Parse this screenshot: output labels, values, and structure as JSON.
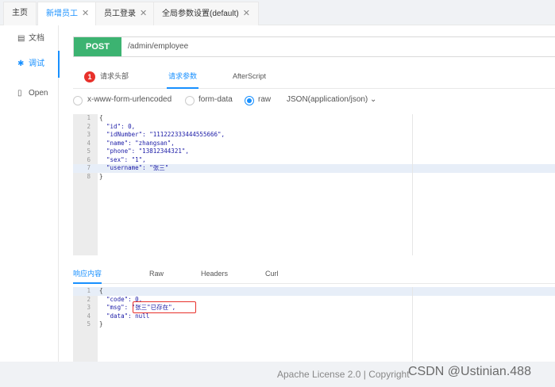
{
  "tabs": [
    {
      "label": "主页",
      "closable": false
    },
    {
      "label": "新增员工",
      "closable": true
    },
    {
      "label": "员工登录",
      "closable": true
    },
    {
      "label": "全局参数设置(default)",
      "closable": true
    }
  ],
  "sidebar": {
    "items": [
      {
        "label": "文档"
      },
      {
        "label": "调试"
      },
      {
        "label": "Open"
      }
    ]
  },
  "request": {
    "method": "POST",
    "url": "/admin/employee",
    "subtabs": {
      "headers_badge": "1",
      "headers": "请求头部",
      "params": "请求参数",
      "after_script": "AfterScript"
    },
    "body_types": {
      "urlencoded": "x-www-form-urlencoded",
      "form_data": "form-data",
      "raw": "raw",
      "raw_format": "JSON(application/json)"
    },
    "lines": [
      {
        "num": "1",
        "text": "{"
      },
      {
        "num": "2",
        "text": "  \"id\": 0,"
      },
      {
        "num": "3",
        "text": "  \"idNumber\": \"111222333444555666\","
      },
      {
        "num": "4",
        "text": "  \"name\": \"zhangsan\","
      },
      {
        "num": "5",
        "text": "  \"phone\": \"13812344321\","
      },
      {
        "num": "6",
        "text": "  \"sex\": \"1\","
      },
      {
        "num": "7",
        "text": "  \"username\": \"张三\""
      },
      {
        "num": "8",
        "text": "}"
      }
    ]
  },
  "response": {
    "tabs": {
      "content": "响应内容",
      "raw": "Raw",
      "headers": "Headers",
      "curl": "Curl"
    },
    "lines": [
      {
        "num": "1",
        "text": "{"
      },
      {
        "num": "2",
        "text": "  \"code\": 0,"
      },
      {
        "num": "3",
        "text": "  \"msg\": \"张三\"已存在\","
      },
      {
        "num": "4",
        "text": "  \"data\": null"
      },
      {
        "num": "5",
        "text": "}"
      }
    ]
  },
  "footer": {
    "text": "Apache License 2.0 | Copyright",
    "watermark": "CSDN @Ustinian.488"
  },
  "colors": {
    "accent": "#1890ff",
    "post_method": "#3cb371",
    "badge": "#e8312b",
    "highlight_box": "#e8312b"
  }
}
